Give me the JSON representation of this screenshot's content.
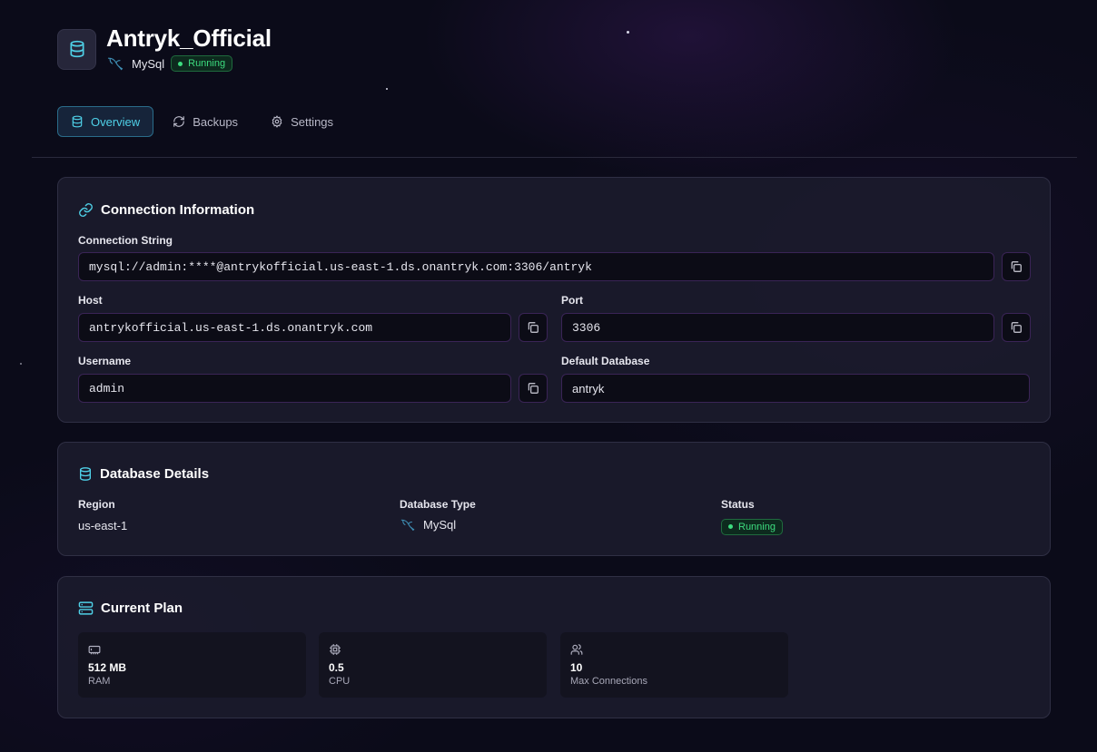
{
  "header": {
    "title": "Antryk_Official",
    "engine": "MySql",
    "status": "Running",
    "icon": "database-icon"
  },
  "tabs": [
    {
      "label": "Overview",
      "icon": "database-icon",
      "active": true
    },
    {
      "label": "Backups",
      "icon": "refresh-icon",
      "active": false
    },
    {
      "label": "Settings",
      "icon": "gear-icon",
      "active": false
    }
  ],
  "connection": {
    "title": "Connection Information",
    "string_label": "Connection String",
    "string_value": "mysql://admin:****@antrykofficial.us-east-1.ds.onantryk.com:3306/antryk",
    "host_label": "Host",
    "host_value": "antrykofficial.us-east-1.ds.onantryk.com",
    "port_label": "Port",
    "port_value": "3306",
    "username_label": "Username",
    "username_value": "admin",
    "database_label": "Default Database",
    "database_value": "antryk"
  },
  "details": {
    "title": "Database Details",
    "region_label": "Region",
    "region_value": "us-east-1",
    "type_label": "Database Type",
    "type_value": "MySql",
    "status_label": "Status",
    "status_value": "Running"
  },
  "plan": {
    "title": "Current Plan",
    "items": [
      {
        "value": "512 MB",
        "label": "RAM",
        "icon": "memory-icon"
      },
      {
        "value": "0.5",
        "label": "CPU",
        "icon": "cpu-icon"
      },
      {
        "value": "10",
        "label": "Max Connections",
        "icon": "users-icon"
      }
    ]
  },
  "colors": {
    "accent": "#4fd1e8",
    "status_green": "#3ddc7f",
    "background": "#0b0b19",
    "card": "#1b1b2c"
  }
}
